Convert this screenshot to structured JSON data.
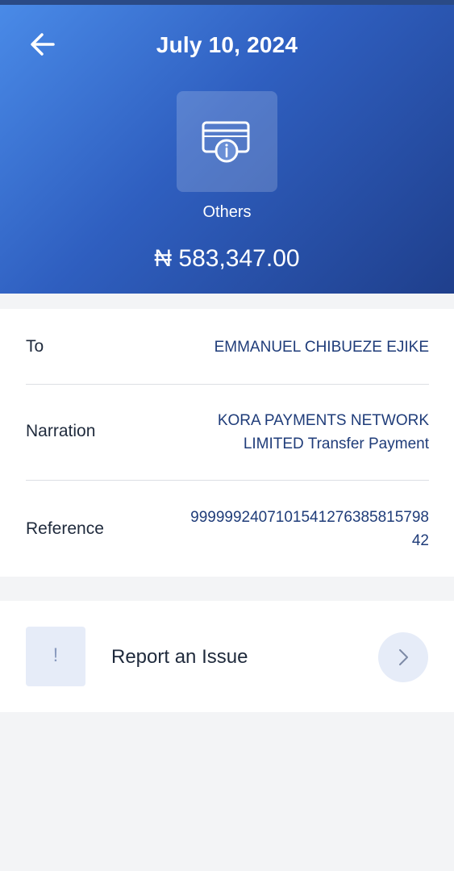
{
  "header": {
    "date": "July 10, 2024",
    "category": "Others",
    "amount": "₦ 583,347.00"
  },
  "details": {
    "to_label": "To",
    "to_value": "EMMANUEL CHIBUEZE EJIKE",
    "narration_label": "Narration",
    "narration_line1": "KORA PAYMENTS NETWORK",
    "narration_line2": "LIMITED Transfer Payment",
    "reference_label": "Reference",
    "reference_line1": "999999240710154127638581579​8",
    "reference_line2": "42"
  },
  "issue": {
    "icon_glyph": "!",
    "label": "Report an Issue"
  },
  "icons": {
    "back": "arrow-left-icon",
    "category": "card-info-icon",
    "issue": "exclamation-icon",
    "chevron": "chevron-right-icon"
  },
  "colors": {
    "header_start": "#4a8be8",
    "header_end": "#1f3f8c",
    "value_text": "#1f3c79",
    "icon_bg": "#e6ecf8"
  }
}
